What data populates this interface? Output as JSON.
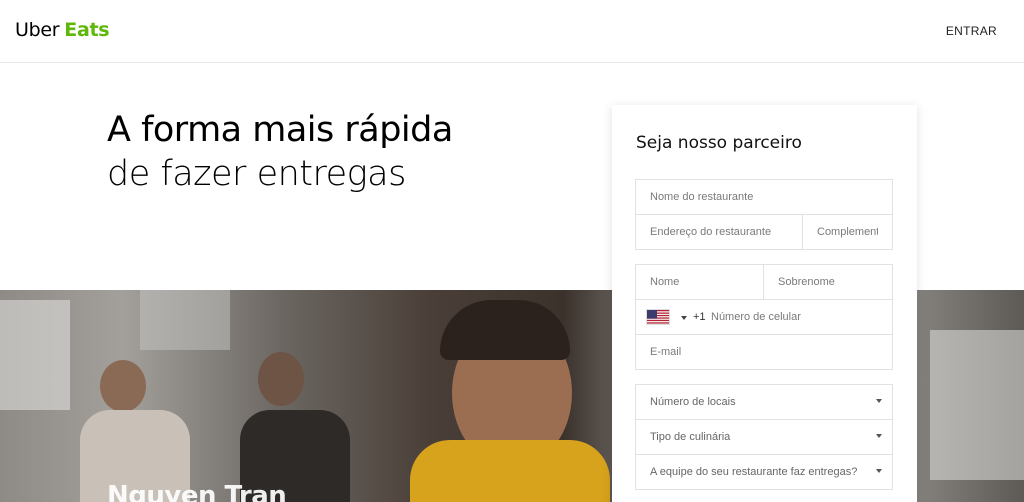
{
  "header": {
    "brand_uber": "Uber",
    "brand_eats": "Eats",
    "signin_label": "ENTRAR"
  },
  "hero": {
    "title_line1": "A forma mais rápida",
    "title_line2": "de fazer entregas",
    "photo_caption": "Nguyen Tran"
  },
  "form": {
    "title": "Seja nosso parceiro",
    "restaurant_name_placeholder": "Nome do restaurante",
    "restaurant_address_placeholder": "Endereço do restaurante",
    "complement_placeholder": "Complemento",
    "first_name_placeholder": "Nome",
    "last_name_placeholder": "Sobrenome",
    "phone_country_code": "+1",
    "phone_placeholder": "Número de celular",
    "email_placeholder": "E-mail",
    "locations_select": "Número de locais",
    "cuisine_select": "Tipo de culinária",
    "delivery_select": "A equipe do seu restaurante faz entregas?"
  },
  "colors": {
    "brand_green": "#5fb709",
    "text": "#000000",
    "border": "#e2e2e2"
  },
  "icons": {
    "country_flag": "us-flag-icon",
    "dropdown": "caret-down-icon"
  }
}
